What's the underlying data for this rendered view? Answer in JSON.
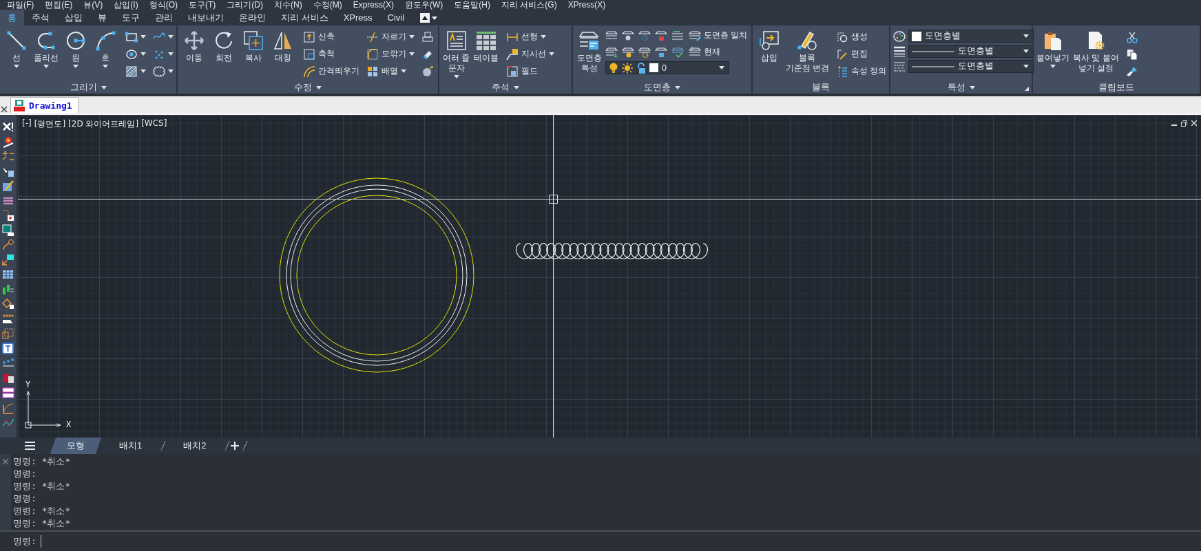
{
  "menu_bar": [
    "파일(F)",
    "편집(E)",
    "뷰(V)",
    "삽입(I)",
    "형식(O)",
    "도구(T)",
    "그리기(D)",
    "치수(N)",
    "수정(M)",
    "Express(X)",
    "윈도우(W)",
    "도움말(H)",
    "지리 서비스(G)",
    "XPress(X)"
  ],
  "ribbon_tabs": [
    {
      "label": "홈",
      "selected": true
    },
    {
      "label": "주석",
      "selected": false
    },
    {
      "label": "삽입",
      "selected": false
    },
    {
      "label": "뷰",
      "selected": false
    },
    {
      "label": "도구",
      "selected": false
    },
    {
      "label": "관리",
      "selected": false
    },
    {
      "label": "내보내기",
      "selected": false
    },
    {
      "label": "온라인",
      "selected": false
    },
    {
      "label": "지리 서비스",
      "selected": false
    },
    {
      "label": "XPress",
      "selected": false
    },
    {
      "label": "Civil",
      "selected": false
    }
  ],
  "ribbon_panels": [
    {
      "title": "그리기",
      "title_menu": true,
      "launcher": false,
      "items": [
        {
          "kind": "large",
          "label": "선",
          "dropdown": true
        },
        {
          "kind": "large",
          "label": "폴리선",
          "dropdown": true
        },
        {
          "kind": "large",
          "label": "원",
          "dropdown": true
        },
        {
          "kind": "large",
          "label": "호",
          "dropdown": true
        },
        {
          "kind": "stack",
          "tools": [
            {
              "dropdown": true
            },
            {
              "dropdown": true
            },
            {
              "dropdown": true
            }
          ]
        },
        {
          "kind": "stack",
          "tools": [
            {
              "dropdown": true
            },
            {
              "dropdown": true
            },
            {
              "dropdown": true
            }
          ]
        }
      ]
    },
    {
      "title": "수정",
      "title_menu": true,
      "launcher": false,
      "items": [
        {
          "kind": "large",
          "label": "이동",
          "dropdown": false
        },
        {
          "kind": "large",
          "label": "회전",
          "dropdown": false
        },
        {
          "kind": "large",
          "label": "복사",
          "dropdown": false
        },
        {
          "kind": "large",
          "label": "대칭",
          "dropdown": false
        },
        {
          "kind": "stack",
          "tools": [
            {
              "label": "신축",
              "dropdown": false
            },
            {
              "label": "축척",
              "dropdown": false
            },
            {
              "label": "간격띄우기",
              "dropdown": false
            }
          ]
        },
        {
          "kind": "stack",
          "tools": [
            {
              "label": "자르기",
              "dropdown": true
            },
            {
              "label": "모깎기",
              "dropdown": true
            },
            {
              "label": "배열",
              "dropdown": true
            }
          ]
        },
        {
          "kind": "stack",
          "tools": [
            {
              "dropdown": false
            },
            {
              "dropdown": false
            },
            {
              "dropdown": false
            }
          ]
        }
      ]
    },
    {
      "title": "주석",
      "title_menu": true,
      "launcher": false,
      "items": [
        {
          "kind": "large",
          "label": "여러 줄\n문자",
          "dropdown": true
        },
        {
          "kind": "large",
          "label": "테이블",
          "dropdown": false
        },
        {
          "kind": "stack",
          "tools": [
            {
              "label": "선형",
              "dropdown": true
            },
            {
              "label": "지시선",
              "dropdown": true
            },
            {
              "label": "필드",
              "dropdown": false
            }
          ]
        }
      ]
    },
    {
      "title": "도면층",
      "title_menu": true,
      "launcher": false,
      "items": [
        {
          "kind": "large",
          "label": "도면층\n특성",
          "dropdown": false
        },
        {
          "kind": "layer_block",
          "rows": [
            {
              "label": "도면층 일치"
            },
            {
              "label": "현재"
            }
          ],
          "current_layer": "0"
        }
      ]
    },
    {
      "title": "블록",
      "title_menu": false,
      "launcher": false,
      "items": [
        {
          "kind": "large",
          "label": "삽입",
          "dropdown": false
        },
        {
          "kind": "large",
          "label": "블록\n기준점 변경",
          "dropdown": false
        },
        {
          "kind": "stack",
          "tools": [
            {
              "label": "생성",
              "dropdown": false
            },
            {
              "label": "편집",
              "dropdown": false
            },
            {
              "label": "속성 정의",
              "dropdown": false
            }
          ]
        }
      ]
    },
    {
      "title": "특성",
      "title_menu": true,
      "launcher": true,
      "items": [
        {
          "kind": "combos",
          "combos": [
            {
              "kind": "color",
              "value": "도면층별"
            },
            {
              "kind": "lineweight",
              "value": "도면층별"
            },
            {
              "kind": "linetype",
              "value": "도면층별"
            }
          ]
        }
      ]
    },
    {
      "title": "클립보드",
      "title_menu": false,
      "launcher": false,
      "items": [
        {
          "kind": "large",
          "label": "붙여넣기",
          "dropdown": true
        },
        {
          "kind": "large",
          "label": "복사 및 붙여\n넣기 설정",
          "dropdown": false
        },
        {
          "kind": "stack",
          "tools": [
            {
              "dropdown": false
            },
            {
              "dropdown": false
            },
            {
              "dropdown": false
            }
          ]
        }
      ]
    }
  ],
  "document_tabs": [
    {
      "label": "Drawing1",
      "selected": true
    }
  ],
  "viewport": {
    "controls": [
      "[-]",
      "[평면도]",
      "[2D 와이어프레임]",
      "[WCS]"
    ],
    "ucs": {
      "y_label": "Y",
      "x_label": "X"
    }
  },
  "layout_tabs": [
    {
      "label": "모형",
      "selected": true
    },
    {
      "label": "배치1",
      "selected": false
    },
    {
      "label": "배치2",
      "selected": false
    }
  ],
  "command_history": [
    "명령: *취소*",
    "명령:",
    "명령: *취소*",
    "명령:",
    "명령: *취소*",
    "명령: *취소*"
  ],
  "command_line": {
    "prompt": "명령:"
  }
}
